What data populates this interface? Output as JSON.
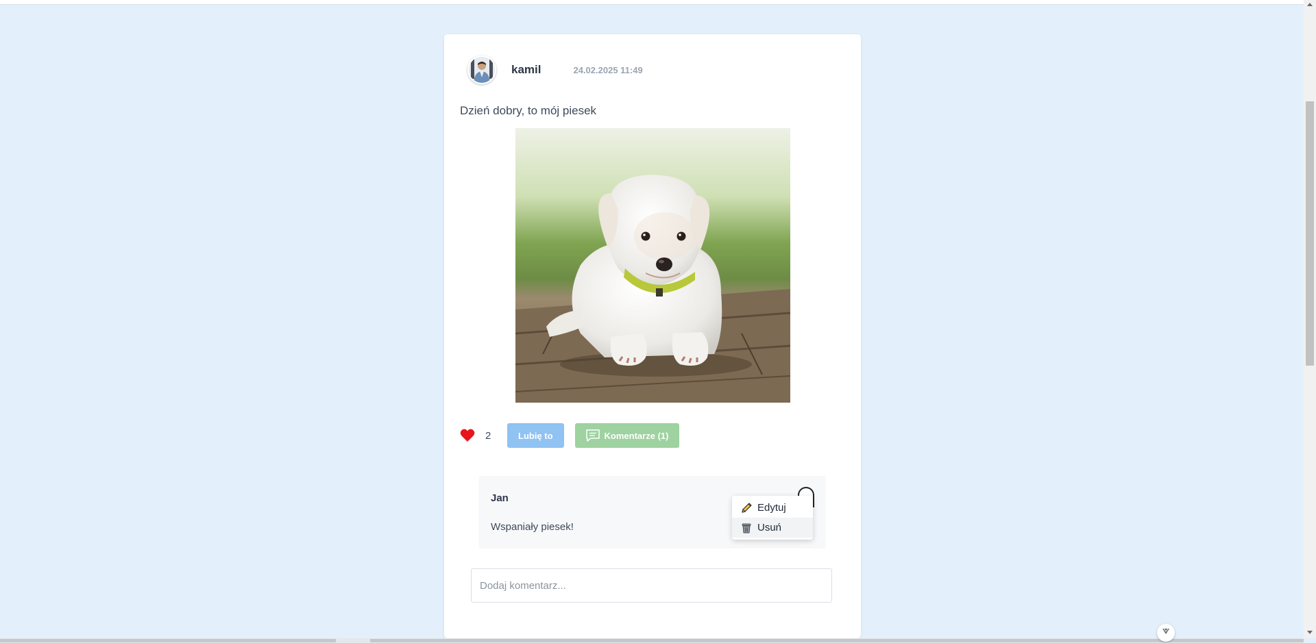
{
  "post": {
    "author": "kamil",
    "date": "24.02.2025 11:49",
    "text": "Dzień dobry, to mój piesek",
    "likes": "2",
    "like_label": "Lubię to",
    "comments_label": "Komentarze (1)"
  },
  "comment": {
    "author": "Jan",
    "text": "Wspaniały piesek!",
    "menu": {
      "edit_label": "Edytuj",
      "delete_label": "Usuń"
    }
  },
  "new_comment": {
    "placeholder": "Dodaj komentarz...",
    "value": ""
  },
  "icons": {
    "like": "heart-icon",
    "comments": "chat-bubble-icon",
    "edit": "pencil-icon",
    "delete": "trash-icon",
    "menu": "kebab-menu-icon",
    "scroll": "chevron-down-icon"
  },
  "colors": {
    "page_background": "#e3f0fb",
    "card_background": "#ffffff",
    "like_button": "#90c2f2",
    "comments_button": "#9ed2a0",
    "heart": "#e8141b",
    "date_text": "#9aa5b1"
  }
}
